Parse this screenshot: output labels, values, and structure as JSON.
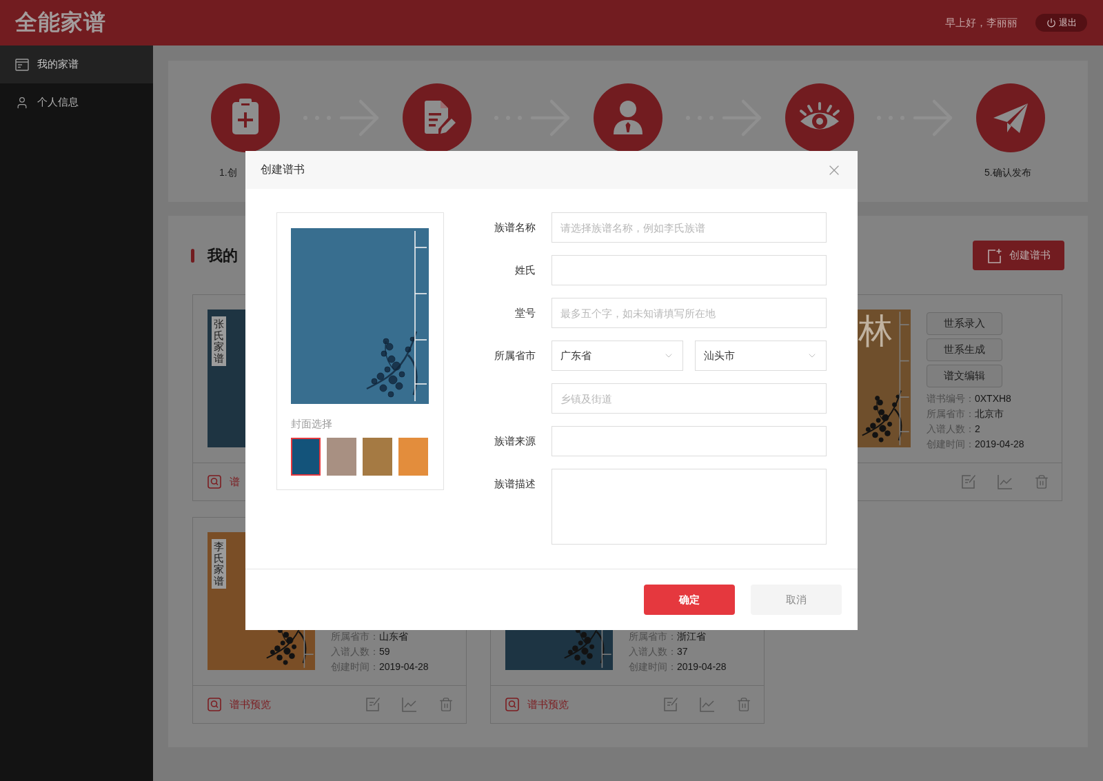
{
  "header": {
    "logo": "全能家谱",
    "greeting": "早上好，李丽丽",
    "logout": "退出"
  },
  "sidebar": {
    "items": [
      {
        "label": "我的家谱",
        "selected": true
      },
      {
        "label": "个人信息",
        "selected": false
      }
    ]
  },
  "steps": [
    {
      "kind": "create",
      "label": "1.创"
    },
    {
      "kind": "edit"
    },
    {
      "kind": "person"
    },
    {
      "kind": "preview"
    },
    {
      "kind": "publish",
      "label": "5.确认发布"
    }
  ],
  "section": {
    "title": "我的",
    "create_button": "创建谱书"
  },
  "books": [
    {
      "color": "#1e3442",
      "title": {
        "kind": "label",
        "text": "张氏家谱"
      },
      "preview": "谱"
    },
    {
      "color": "#6f4f2c",
      "title": {
        "kind": "large",
        "text": "林"
      },
      "buttons": [
        "世系录入",
        "世系生成",
        "谱文编辑"
      ],
      "info": [
        {
          "label": "谱书编号：",
          "value": "0XTXH8"
        },
        {
          "label": "所属省市：",
          "value": "北京市"
        },
        {
          "label": "入谱人数：",
          "value": "2"
        },
        {
          "label": "创建时间：",
          "value": "2019-04-28"
        }
      ],
      "tools": true
    },
    {
      "color": "#7a4e26",
      "title": {
        "kind": "label",
        "text": "李氏家谱"
      },
      "info": [
        {
          "label": "所属省市：",
          "value": "山东省"
        },
        {
          "label": "入谱人数：",
          "value": "59"
        },
        {
          "label": "创建时间：",
          "value": "2019-04-28"
        }
      ],
      "preview": "谱书预览",
      "tools": true
    },
    {
      "color": "#1d3443",
      "info": [
        {
          "label": "所属省市：",
          "value": "浙江省"
        },
        {
          "label": "入谱人数：",
          "value": "37"
        },
        {
          "label": "创建时间：",
          "value": "2019-04-28"
        }
      ],
      "preview": "谱书预览",
      "tools": true
    }
  ],
  "dialog": {
    "title": "创建谱书",
    "cover_caption": "封面选择",
    "covers": [
      {
        "color": "#13537a",
        "selected": true
      },
      {
        "color": "#a89082",
        "selected": false
      },
      {
        "color": "#a57a43",
        "selected": false
      },
      {
        "color": "#e38d3c",
        "selected": false
      }
    ],
    "fields": [
      {
        "kind": "input",
        "label": "族谱名称",
        "placeholder": "请选择族谱名称，例如李氏族谱"
      },
      {
        "kind": "input",
        "label": "姓氏"
      },
      {
        "kind": "input",
        "label": "堂号",
        "placeholder": "最多五个字，如未知请填写所在地"
      },
      {
        "kind": "selects",
        "label": "所属省市",
        "selects": [
          {
            "value": "广东省"
          },
          {
            "value": "汕头市"
          }
        ]
      },
      {
        "kind": "input",
        "placeholder": "乡镇及街道"
      },
      {
        "kind": "input",
        "label": "族谱来源"
      },
      {
        "kind": "textarea",
        "label": "族谱描述"
      }
    ],
    "buttons": [
      {
        "kind": "primary",
        "label": "确定"
      },
      {
        "kind": "secondary",
        "label": "取消"
      }
    ]
  }
}
